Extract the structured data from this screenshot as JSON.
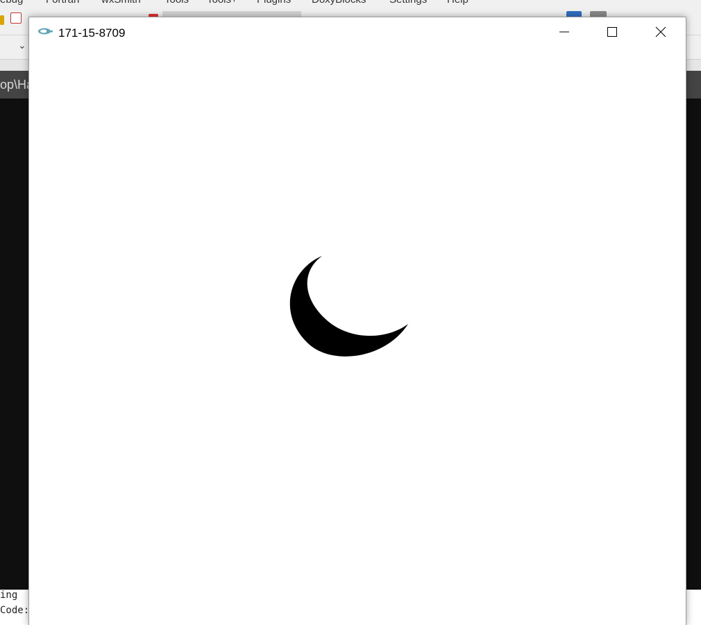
{
  "background_ide": {
    "menu_items": [
      "ebug",
      "Fortran",
      "wxSmith",
      "Tools",
      "Tools+",
      "Plugins",
      "DoxyBlocks",
      "Settings",
      "Help"
    ],
    "path_fragment": "op\\Ha",
    "log_lines": [
      "ing",
      "Code:"
    ]
  },
  "window": {
    "title": "171-15-8709",
    "app_icon": "opengl-glut-icon",
    "controls": {
      "minimize": "minimize-icon",
      "maximize": "maximize-icon",
      "close": "close-icon"
    }
  },
  "canvas": {
    "background_color": "#ffffff",
    "shape": "crescent-moon",
    "shape_color": "#000000"
  }
}
